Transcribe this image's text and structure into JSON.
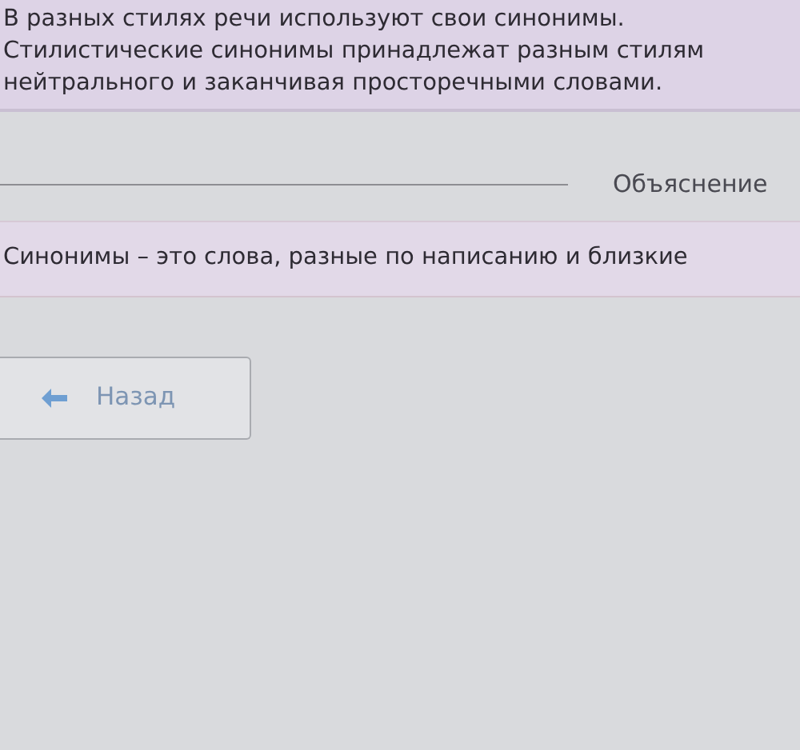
{
  "summary": {
    "lines": [
      "В разных стилях речи используют свои синонимы.",
      "Стилистические синонимы принадлежат разным стилям",
      "нейтрального и заканчивая просторечными словами."
    ]
  },
  "explanation": {
    "label": "Объяснение",
    "text": "Синонимы – это слова, разные по написанию и близкие"
  },
  "back_button": {
    "label": "Назад"
  }
}
